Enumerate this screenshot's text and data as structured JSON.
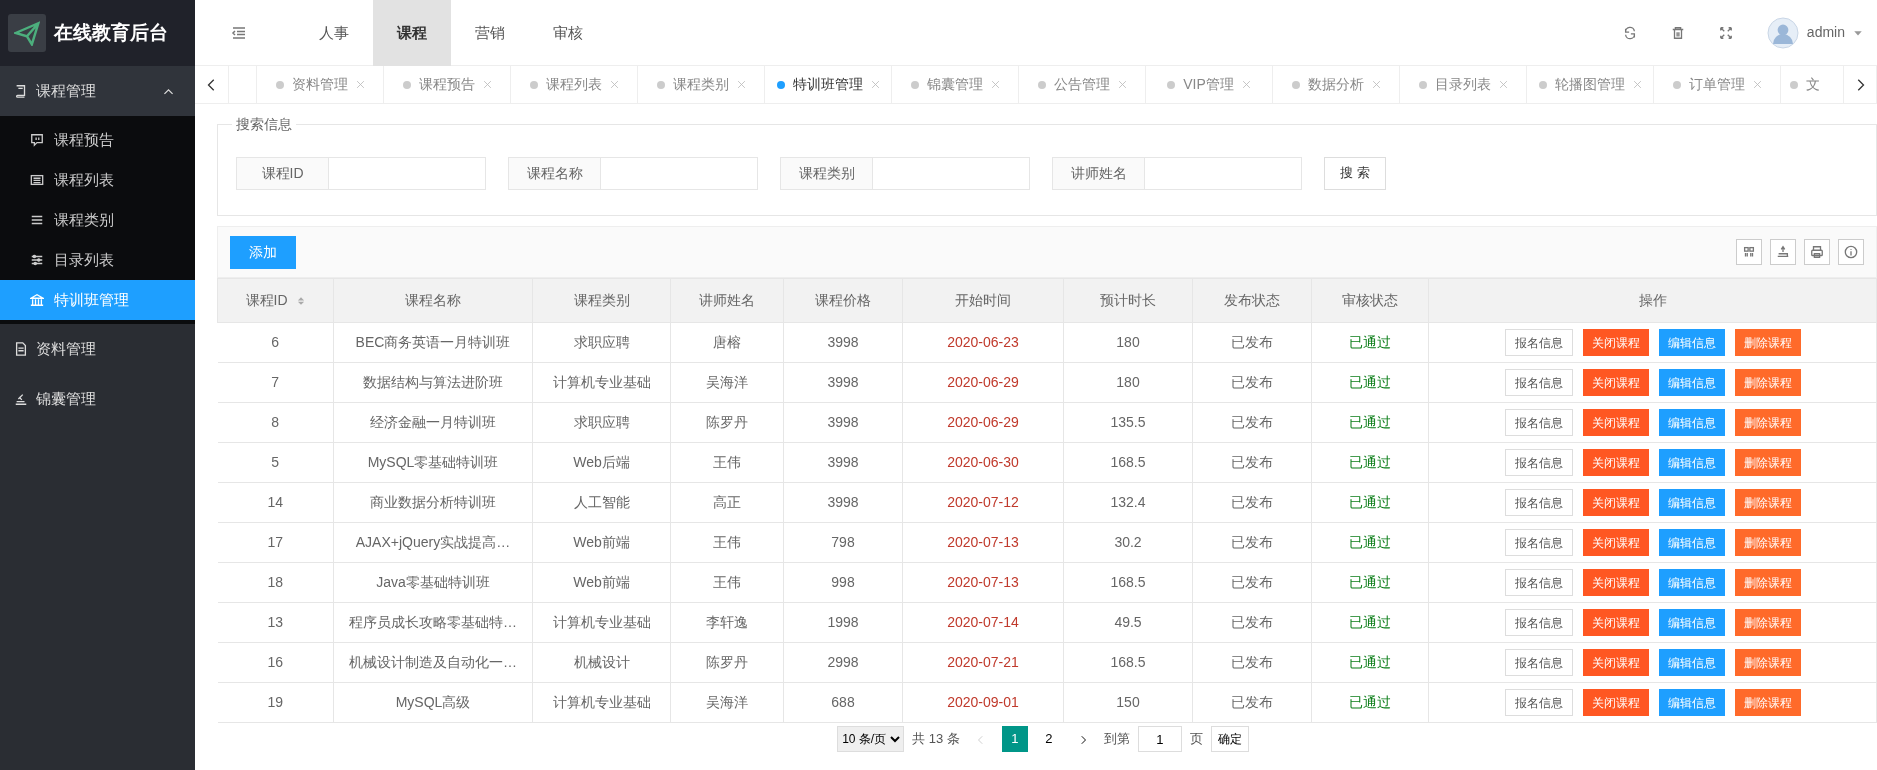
{
  "sidebar": {
    "logo": "在线教育后台",
    "groups": [
      {
        "label": "课程管理",
        "expanded": true,
        "children": [
          {
            "label": "课程预告",
            "selected": false
          },
          {
            "label": "课程列表",
            "selected": false
          },
          {
            "label": "课程类别",
            "selected": false
          },
          {
            "label": "目录列表",
            "selected": false
          },
          {
            "label": "特训班管理",
            "selected": true
          }
        ]
      },
      {
        "label": "资料管理"
      },
      {
        "label": "锦囊管理"
      }
    ]
  },
  "header": {
    "nav": [
      {
        "label": "人事",
        "selected": false
      },
      {
        "label": "课程",
        "selected": true
      },
      {
        "label": "营销",
        "selected": false
      },
      {
        "label": "审核",
        "selected": false
      }
    ],
    "user": "admin"
  },
  "tabs": [
    {
      "label": "资料管理",
      "selected": false
    },
    {
      "label": "课程预告",
      "selected": false
    },
    {
      "label": "课程列表",
      "selected": false
    },
    {
      "label": "课程类别",
      "selected": false
    },
    {
      "label": "特训班管理",
      "selected": true
    },
    {
      "label": "锦囊管理",
      "selected": false
    },
    {
      "label": "公告管理",
      "selected": false
    },
    {
      "label": "VIP管理",
      "selected": false
    },
    {
      "label": "数据分析",
      "selected": false
    },
    {
      "label": "目录列表",
      "selected": false
    },
    {
      "label": "轮播图管理",
      "selected": false
    },
    {
      "label": "订单管理",
      "selected": false
    },
    {
      "label": "文",
      "selected": false
    }
  ],
  "search": {
    "title": "搜索信息",
    "fields": [
      {
        "label": "课程ID"
      },
      {
        "label": "课程名称"
      },
      {
        "label": "课程类别"
      },
      {
        "label": "讲师姓名"
      }
    ],
    "button": "搜 索"
  },
  "toolbar": {
    "add_button": "添加"
  },
  "table": {
    "columns": [
      {
        "label": "课程ID",
        "sortable": true
      },
      {
        "label": "课程名称"
      },
      {
        "label": "课程类别"
      },
      {
        "label": "讲师姓名"
      },
      {
        "label": "课程价格"
      },
      {
        "label": "开始时间"
      },
      {
        "label": "预计时长"
      },
      {
        "label": "发布状态"
      },
      {
        "label": "审核状态"
      },
      {
        "label": "操作"
      }
    ],
    "rows": [
      {
        "cells": [
          "6",
          "BEC商务英语一月特训班",
          "求职应聘",
          "唐榕",
          "3998",
          "2020-06-23",
          "180",
          "已发布",
          "已通过"
        ],
        "actions": [
          {
            "label": "报名信息",
            "kind": "plain"
          },
          {
            "label": "关闭课程",
            "kind": "warn"
          },
          {
            "label": "编辑信息",
            "kind": "primary"
          },
          {
            "label": "删除课程",
            "kind": "danger"
          }
        ]
      },
      {
        "cells": [
          "7",
          "数据结构与算法进阶班",
          "计算机专业基础",
          "吴海洋",
          "3998",
          "2020-06-29",
          "180",
          "已发布",
          "已通过"
        ],
        "actions": [
          {
            "label": "报名信息",
            "kind": "plain"
          },
          {
            "label": "关闭课程",
            "kind": "warn"
          },
          {
            "label": "编辑信息",
            "kind": "primary"
          },
          {
            "label": "删除课程",
            "kind": "danger"
          }
        ]
      },
      {
        "cells": [
          "8",
          "经济金融一月特训班",
          "求职应聘",
          "陈罗丹",
          "3998",
          "2020-06-29",
          "135.5",
          "已发布",
          "已通过"
        ],
        "actions": [
          {
            "label": "报名信息",
            "kind": "plain"
          },
          {
            "label": "关闭课程",
            "kind": "warn"
          },
          {
            "label": "编辑信息",
            "kind": "primary"
          },
          {
            "label": "删除课程",
            "kind": "danger"
          }
        ]
      },
      {
        "cells": [
          "5",
          "MySQL零基础特训班",
          "Web后端",
          "王伟",
          "3998",
          "2020-06-30",
          "168.5",
          "已发布",
          "已通过"
        ],
        "actions": [
          {
            "label": "报名信息",
            "kind": "plain"
          },
          {
            "label": "关闭课程",
            "kind": "warn"
          },
          {
            "label": "编辑信息",
            "kind": "primary"
          },
          {
            "label": "删除课程",
            "kind": "danger"
          }
        ]
      },
      {
        "cells": [
          "14",
          "商业数据分析特训班",
          "人工智能",
          "高正",
          "3998",
          "2020-07-12",
          "132.4",
          "已发布",
          "已通过"
        ],
        "actions": [
          {
            "label": "报名信息",
            "kind": "plain"
          },
          {
            "label": "关闭课程",
            "kind": "warn"
          },
          {
            "label": "编辑信息",
            "kind": "primary"
          },
          {
            "label": "删除课程",
            "kind": "danger"
          }
        ]
      },
      {
        "cells": [
          "17",
          "AJAX+jQuery实战提高…",
          "Web前端",
          "王伟",
          "798",
          "2020-07-13",
          "30.2",
          "已发布",
          "已通过"
        ],
        "actions": [
          {
            "label": "报名信息",
            "kind": "plain"
          },
          {
            "label": "关闭课程",
            "kind": "warn"
          },
          {
            "label": "编辑信息",
            "kind": "primary"
          },
          {
            "label": "删除课程",
            "kind": "danger"
          }
        ]
      },
      {
        "cells": [
          "18",
          "Java零基础特训班",
          "Web前端",
          "王伟",
          "998",
          "2020-07-13",
          "168.5",
          "已发布",
          "已通过"
        ],
        "actions": [
          {
            "label": "报名信息",
            "kind": "plain"
          },
          {
            "label": "关闭课程",
            "kind": "warn"
          },
          {
            "label": "编辑信息",
            "kind": "primary"
          },
          {
            "label": "删除课程",
            "kind": "danger"
          }
        ]
      },
      {
        "cells": [
          "13",
          "程序员成长攻略零基础特…",
          "计算机专业基础",
          "李轩逸",
          "1998",
          "2020-07-14",
          "49.5",
          "已发布",
          "已通过"
        ],
        "actions": [
          {
            "label": "报名信息",
            "kind": "plain"
          },
          {
            "label": "关闭课程",
            "kind": "warn"
          },
          {
            "label": "编辑信息",
            "kind": "primary"
          },
          {
            "label": "删除课程",
            "kind": "danger"
          }
        ]
      },
      {
        "cells": [
          "16",
          "机械设计制造及自动化一…",
          "机械设计",
          "陈罗丹",
          "2998",
          "2020-07-21",
          "168.5",
          "已发布",
          "已通过"
        ],
        "actions": [
          {
            "label": "报名信息",
            "kind": "plain"
          },
          {
            "label": "关闭课程",
            "kind": "warn"
          },
          {
            "label": "编辑信息",
            "kind": "primary"
          },
          {
            "label": "删除课程",
            "kind": "danger"
          }
        ]
      },
      {
        "cells": [
          "19",
          "MySQL高级",
          "计算机专业基础",
          "吴海洋",
          "688",
          "2020-09-01",
          "150",
          "已发布",
          "已通过"
        ],
        "actions": [
          {
            "label": "报名信息",
            "kind": "plain"
          },
          {
            "label": "关闭课程",
            "kind": "warn"
          },
          {
            "label": "编辑信息",
            "kind": "primary"
          },
          {
            "label": "删除课程",
            "kind": "danger"
          }
        ]
      }
    ]
  },
  "pagination": {
    "page_size": "10 条/页",
    "total": "共 13 条",
    "prev_disabled": true,
    "pages": [
      {
        "label": "1",
        "selected": true
      },
      {
        "label": "2",
        "selected": false
      }
    ],
    "goto_label": "到第",
    "goto_value": "1",
    "page_unit": "页",
    "confirm": "确定"
  }
}
